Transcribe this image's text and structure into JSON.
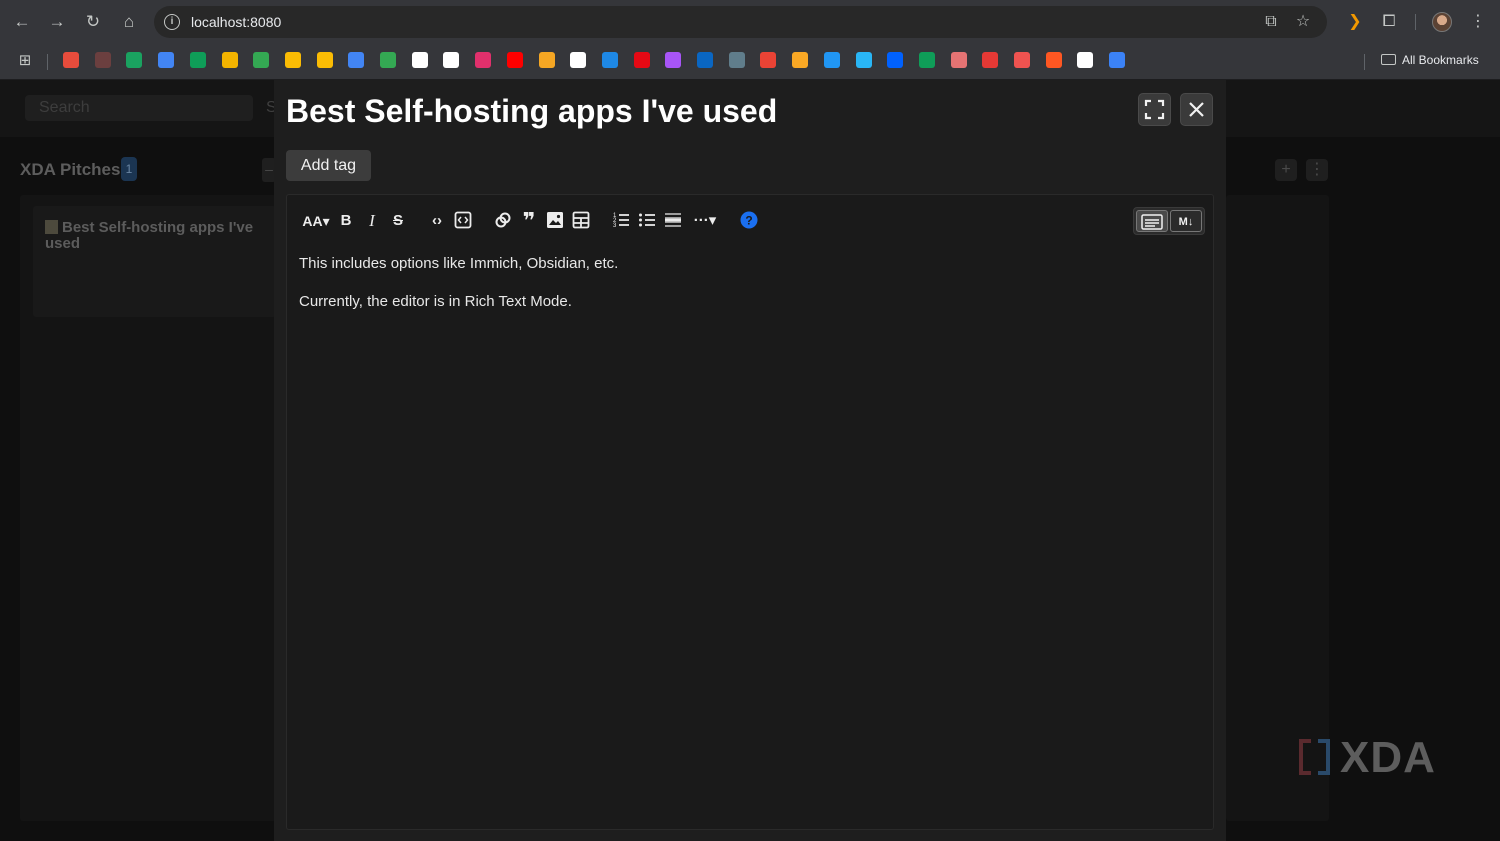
{
  "browser": {
    "url": "localhost:8080",
    "all_bookmarks_label": "All Bookmarks",
    "bookmark_colors": [
      "#e74c3c",
      "#6b3f3f",
      "#1aa260",
      "#4285f4",
      "#0f9d58",
      "#f4b400",
      "#34a853",
      "#fbbc04",
      "#fbbc04",
      "#4285f4",
      "#34a853",
      "#ffffff",
      "#ffffff",
      "#e1306c",
      "#ff0000",
      "#f5a623",
      "#ffffff",
      "#1e88e5",
      "#e50914",
      "#a855f7",
      "#0a66c2",
      "#607d8b",
      "#ea4335",
      "#f9a825",
      "#2196f3",
      "#29b6f6",
      "#0061fe",
      "#0f9d58",
      "#e57373",
      "#e53935",
      "#ef5350",
      "#ff5722",
      "#ffffff",
      "#3b82f6"
    ]
  },
  "app": {
    "search_placeholder": "Search",
    "header_partial": "S",
    "board_title": "XDA Pitches",
    "board_count": "1",
    "card_title": "Best Self-hosting apps I've used",
    "watermark": "XDA"
  },
  "modal": {
    "title": "Best Self-hosting apps I've used",
    "add_tag_label": "Add tag",
    "content": [
      "This includes options like Immich, Obsidian, etc.",
      "Currently, the editor is in Rich Text Mode."
    ],
    "mode_markdown_label": "M↓"
  }
}
